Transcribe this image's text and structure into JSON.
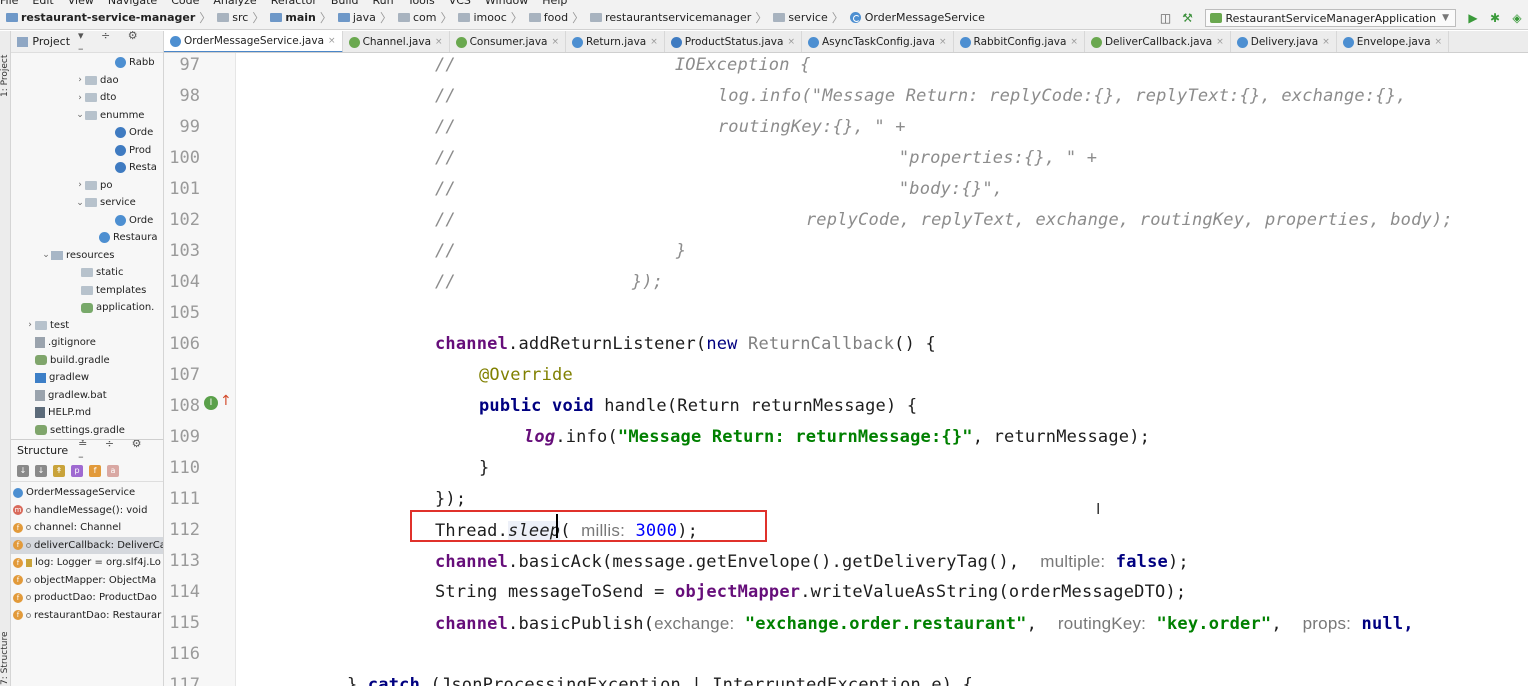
{
  "menu": [
    "File",
    "Edit",
    "View",
    "Navigate",
    "Code",
    "Analyze",
    "Refactor",
    "Build",
    "Run",
    "Tools",
    "VCS",
    "Window",
    "Help"
  ],
  "breadcrumb": {
    "project": "restaurant-service-manager",
    "src": "src",
    "main": "main",
    "java": "java",
    "com": "com",
    "imooc": "imooc",
    "food": "food",
    "pkg": "restaurantservicemanager",
    "service": "service",
    "file": "OrderMessageService"
  },
  "toolbar": {
    "run_config": "RestaurantServiceManagerApplication"
  },
  "side_labels": {
    "project": "1: Project",
    "structure": "7: Structure"
  },
  "project_panel": {
    "title": "Project"
  },
  "tree": [
    {
      "label": "Rabb",
      "icon": "class-icon",
      "indent": 110,
      "arrow": ""
    },
    {
      "label": "dao",
      "icon": "folder-icon",
      "indent": 80,
      "arrow": "›"
    },
    {
      "label": "dto",
      "icon": "folder-icon",
      "indent": 80,
      "arrow": "›"
    },
    {
      "label": "enumme",
      "icon": "folder-icon",
      "indent": 80,
      "arrow": "⌄"
    },
    {
      "label": "Orde",
      "icon": "enum-icon",
      "indent": 110,
      "arrow": ""
    },
    {
      "label": "Prod",
      "icon": "enum-icon",
      "indent": 110,
      "arrow": ""
    },
    {
      "label": "Resta",
      "icon": "enum-icon",
      "indent": 110,
      "arrow": ""
    },
    {
      "label": "po",
      "icon": "folder-icon",
      "indent": 80,
      "arrow": "›"
    },
    {
      "label": "service",
      "icon": "folder-icon",
      "indent": 80,
      "arrow": "⌄"
    },
    {
      "label": "Orde",
      "icon": "class-icon",
      "indent": 110,
      "arrow": "",
      "selected": true
    },
    {
      "label": "Restaura",
      "icon": "spring-class-icon",
      "indent": 94,
      "arrow": ""
    },
    {
      "label": "resources",
      "icon": "resources-folder-icon",
      "indent": 46,
      "arrow": "⌄"
    },
    {
      "label": "static",
      "icon": "folder-icon",
      "indent": 76,
      "arrow": ""
    },
    {
      "label": "templates",
      "icon": "folder-icon",
      "indent": 76,
      "arrow": ""
    },
    {
      "label": "application.",
      "icon": "spring-config-icon",
      "indent": 76,
      "arrow": ""
    },
    {
      "label": "test",
      "icon": "folder-icon",
      "indent": 30,
      "arrow": "›"
    },
    {
      "label": ".gitignore",
      "icon": "file-icon",
      "indent": 30,
      "arrow": ""
    },
    {
      "label": "build.gradle",
      "icon": "gradle-icon",
      "indent": 30,
      "arrow": ""
    },
    {
      "label": "gradlew",
      "icon": "terminal-file-icon",
      "indent": 30,
      "arrow": ""
    },
    {
      "label": "gradlew.bat",
      "icon": "file-icon",
      "indent": 30,
      "arrow": ""
    },
    {
      "label": "HELP.md",
      "icon": "markdown-icon",
      "indent": 30,
      "arrow": ""
    },
    {
      "label": "settings.gradle",
      "icon": "gradle-icon",
      "indent": 30,
      "arrow": ""
    }
  ],
  "structure_panel": {
    "title": "Structure"
  },
  "structure": [
    {
      "label": "OrderMessageService",
      "icon": "class-icon",
      "pad": 0
    },
    {
      "label": "handleMessage(): void",
      "icon": "method-icon",
      "pad": 0
    },
    {
      "label": "channel: Channel",
      "icon": "field-icon",
      "pad": 0
    },
    {
      "label": "deliverCallback: DeliverCa",
      "icon": "field-icon",
      "pad": 0,
      "selected": true
    },
    {
      "label": "log: Logger = org.slf4j.Lo",
      "icon": "static-field-icon",
      "pad": 0
    },
    {
      "label": "objectMapper: ObjectMa",
      "icon": "field-icon",
      "pad": 0
    },
    {
      "label": "productDao: ProductDao",
      "icon": "field-icon",
      "pad": 0
    },
    {
      "label": "restaurantDao: Restaurar",
      "icon": "field-icon",
      "pad": 0
    }
  ],
  "tabs": [
    {
      "label": "OrderMessageService.java",
      "kind": "c",
      "active": true
    },
    {
      "label": "Channel.java",
      "kind": "i"
    },
    {
      "label": "Consumer.java",
      "kind": "i"
    },
    {
      "label": "Return.java",
      "kind": "c"
    },
    {
      "label": "ProductStatus.java",
      "kind": "e"
    },
    {
      "label": "AsyncTaskConfig.java",
      "kind": "c"
    },
    {
      "label": "RabbitConfig.java",
      "kind": "c"
    },
    {
      "label": "DeliverCallback.java",
      "kind": "i"
    },
    {
      "label": "Delivery.java",
      "kind": "c"
    },
    {
      "label": "Envelope.java",
      "kind": "c"
    }
  ],
  "line_numbers": [
    "97",
    "98",
    "99",
    "100",
    "101",
    "102",
    "103",
    "104",
    "105",
    "106",
    "107",
    "108",
    "109",
    "110",
    "111",
    "112",
    "113",
    "114",
    "115",
    "116",
    "117"
  ],
  "code": {
    "l97_cm": "//",
    "l97_b": "IOException {",
    "l98_cm": "//",
    "l98_b": "log.info(\"Message Return: replyCode:{}, replyText:{}, exchange:{},",
    "l99_cm": "//",
    "l99_b": "routingKey:{}, \" +",
    "l100_cm": "//",
    "l100_b": "\"properties:{}, \" +",
    "l101_cm": "//",
    "l101_b": "\"body:{}\",",
    "l102_cm": "//",
    "l102_b": "replyCode, replyText, exchange, routingKey, properties, body);",
    "l103_cm": "//",
    "l103_b": "}",
    "l104_cm": "//",
    "l104_b": "});",
    "l106_channel": "channel",
    "l106_rest1": ".addReturnListener(",
    "l106_new": "new",
    "l106_rc": " ReturnCallback",
    "l106_rest2": "() {",
    "l107": "@Override",
    "l108_kw": "public void",
    "l108_rest": " handle(Return returnMessage) {",
    "l109_log": "log",
    "l109_rest1": ".info(",
    "l109_str": "\"Message Return: returnMessage:{}\"",
    "l109_rest2": ", returnMessage);",
    "l110": "}",
    "l111": "});",
    "l112_a": "Thread.",
    "l112_sleep": "sleep",
    "l112_paren": "(",
    "l112_hint": "millis:",
    "l112_num": "3000",
    "l112_end": ");",
    "l113_channel": "channel",
    "l113_rest": ".basicAck(message.getEnvelope().getDeliveryTag(),",
    "l113_hint": "multiple:",
    "l113_false": "false",
    "l113_end": ");",
    "l114_a": "String messageToSend = ",
    "l114_om": "objectMapper",
    "l114_rest": ".writeValueAsString(orderMessageDTO);",
    "l115_channel": "channel",
    "l115_rest": ".basicPublish(",
    "l115_hint1": "exchange:",
    "l115_str1": "\"exchange.order.restaurant\"",
    "l115_c1": ",",
    "l115_hint2": "routingKey:",
    "l115_str2": "\"key.order\"",
    "l115_c2": ",",
    "l115_hint3": "props:",
    "l115_null": "null,",
    "l117_brace": "} ",
    "l117_catch": "catch",
    "l117_rest": " (JsonProcessingException | InterruptedException e) {"
  },
  "colors": {
    "highlight_box": "#e0312b",
    "accent": "#4a86c8"
  }
}
